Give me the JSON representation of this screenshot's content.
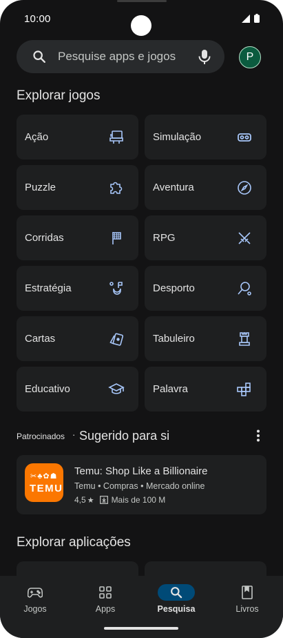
{
  "status_bar": {
    "time": "10:00"
  },
  "search": {
    "placeholder": "Pesquise apps e jogos"
  },
  "account": {
    "initial": "P"
  },
  "explore_games": {
    "title": "Explorar jogos",
    "categories": [
      {
        "label": "Ação",
        "icon": "arcade-cabinet-icon"
      },
      {
        "label": "Simulação",
        "icon": "vr-headset-icon"
      },
      {
        "label": "Puzzle",
        "icon": "puzzle-piece-icon"
      },
      {
        "label": "Aventura",
        "icon": "compass-icon"
      },
      {
        "label": "Corridas",
        "icon": "checkered-flag-icon"
      },
      {
        "label": "RPG",
        "icon": "crossed-swords-icon"
      },
      {
        "label": "Estratégia",
        "icon": "strategy-flag-icon"
      },
      {
        "label": "Desporto",
        "icon": "racket-icon"
      },
      {
        "label": "Cartas",
        "icon": "playing-cards-icon"
      },
      {
        "label": "Tabuleiro",
        "icon": "chess-rook-icon"
      },
      {
        "label": "Educativo",
        "icon": "graduation-cap-icon"
      },
      {
        "label": "Palavra",
        "icon": "word-grid-icon"
      }
    ]
  },
  "suggested": {
    "sponsored_label": "Patrocinados",
    "separator": "·",
    "title": "Sugerido para si",
    "app": {
      "name": "Temu: Shop Like a Billionaire",
      "developer": "Temu",
      "category": "Compras",
      "subcategory": "Mercado online",
      "rating": "4,5",
      "star": "★",
      "downloads": "Mais de 100 M",
      "logo_text": "TEMU",
      "logo_glyphs": "✂♣✿☗",
      "brand_color": "#fb7701"
    }
  },
  "explore_apps": {
    "title": "Explorar aplicações"
  },
  "bottom_nav": [
    {
      "label": "Jogos",
      "icon": "gamepad-icon",
      "active": false
    },
    {
      "label": "Apps",
      "icon": "apps-grid-icon",
      "active": false
    },
    {
      "label": "Pesquisa",
      "icon": "search-icon",
      "active": true
    },
    {
      "label": "Livros",
      "icon": "bookmark-book-icon",
      "active": false
    }
  ],
  "colors": {
    "background": "#131314",
    "tile": "#1e1f20",
    "accent_pill": "#004a77",
    "icon_blue": "#a8c7fa"
  }
}
